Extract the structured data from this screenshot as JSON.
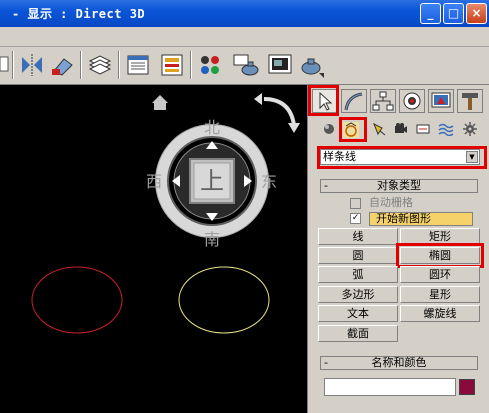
{
  "window": {
    "title": "- 显示 : Direct 3D",
    "minimize_label": "_",
    "maximize_label": "□",
    "close_label": "×"
  },
  "viewport": {
    "compass": {
      "north": "北",
      "south": "南",
      "west": "西",
      "east": "东",
      "cube_face": "上"
    },
    "shapes": [
      {
        "type": "ellipse",
        "color": "#c8202a"
      },
      {
        "type": "ellipse",
        "color": "#e8e480"
      }
    ]
  },
  "command_panel": {
    "tabs": [
      "create",
      "modify",
      "hierarchy",
      "motion",
      "display",
      "utilities"
    ],
    "active_tab": "create",
    "category_icons": [
      "geometry",
      "shapes",
      "lights",
      "cameras",
      "helpers",
      "space-warps",
      "systems"
    ],
    "active_category": "shapes",
    "dropdown_value": "样条线",
    "object_type": {
      "header": "对象类型",
      "autogrid_label": "自动栅格",
      "autogrid_checked": false,
      "start_new_shape_label": "开始新图形",
      "start_new_shape_checked": true,
      "buttons": [
        [
          "线",
          "矩形"
        ],
        [
          "圆",
          "椭圆"
        ],
        [
          "弧",
          "圆环"
        ],
        [
          "多边形",
          "星形"
        ],
        [
          "文本",
          "螺旋线"
        ],
        [
          "截面",
          ""
        ]
      ],
      "highlighted_button": "椭圆"
    },
    "name_color": {
      "header": "名称和颜色",
      "name_value": "",
      "swatch_color": "#8b0a3c"
    }
  },
  "colors": {
    "highlight_box": "#e00000",
    "titlebar": "#0a55d8"
  }
}
